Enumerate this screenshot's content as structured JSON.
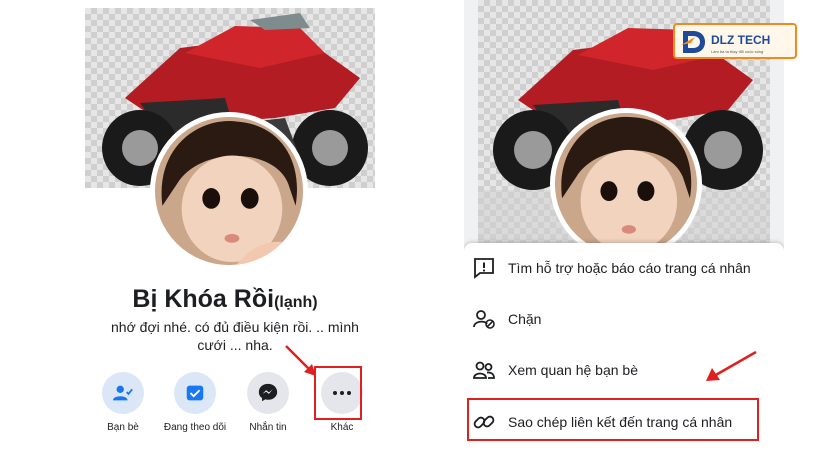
{
  "colors": {
    "facebook_blue": "#1877f2",
    "highlight_red": "#e0201f",
    "text": "#1c1e21"
  },
  "profile": {
    "name": "Bị Khóa Rồi",
    "name_suffix": "(lạnh)",
    "bio": "nhớ đợi nhé. có đủ điều kiện rồi. .. mình cưới ... nha."
  },
  "actions": [
    {
      "label": "Bạn bè",
      "icon": "friends-icon"
    },
    {
      "label": "Đang theo dõi",
      "icon": "following-icon"
    },
    {
      "label": "Nhắn tin",
      "icon": "messenger-icon"
    },
    {
      "label": "Khác",
      "icon": "more-icon"
    }
  ],
  "menu": [
    {
      "label": "Tìm hỗ trợ hoặc báo cáo trang cá nhân",
      "icon": "report-icon"
    },
    {
      "label": "Chặn",
      "icon": "block-icon"
    },
    {
      "label": "Xem quan hệ bạn bè",
      "icon": "friendship-icon"
    },
    {
      "label": "Sao chép liên kết đến trang cá nhân",
      "icon": "link-icon"
    }
  ],
  "logo": {
    "name": "DLZ TECH",
    "tagline": "Làm bà ta thay đổi cuộc sống"
  }
}
